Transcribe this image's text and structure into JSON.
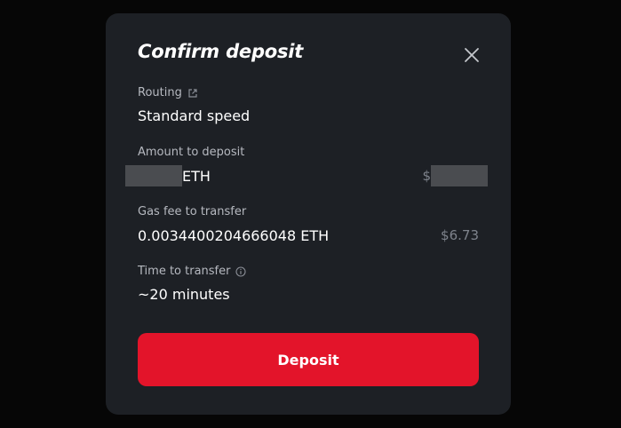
{
  "modal": {
    "title": "Confirm deposit",
    "close_icon": "close-icon"
  },
  "routing": {
    "label": "Routing",
    "icon": "external-link-icon",
    "value": "Standard speed"
  },
  "amount": {
    "label": "Amount to deposit",
    "value_suffix": "ETH",
    "usd_prefix": "$",
    "redacted": true
  },
  "gas_fee": {
    "label": "Gas fee to transfer",
    "value": "0.0034400204666048 ETH",
    "usd": "$6.73"
  },
  "time": {
    "label": "Time to transfer",
    "icon": "info-icon",
    "value": "~20 minutes"
  },
  "actions": {
    "deposit_label": "Deposit"
  },
  "colors": {
    "modal_bg": "#1d2025",
    "accent": "#e3142a",
    "muted": "#7e838c"
  }
}
